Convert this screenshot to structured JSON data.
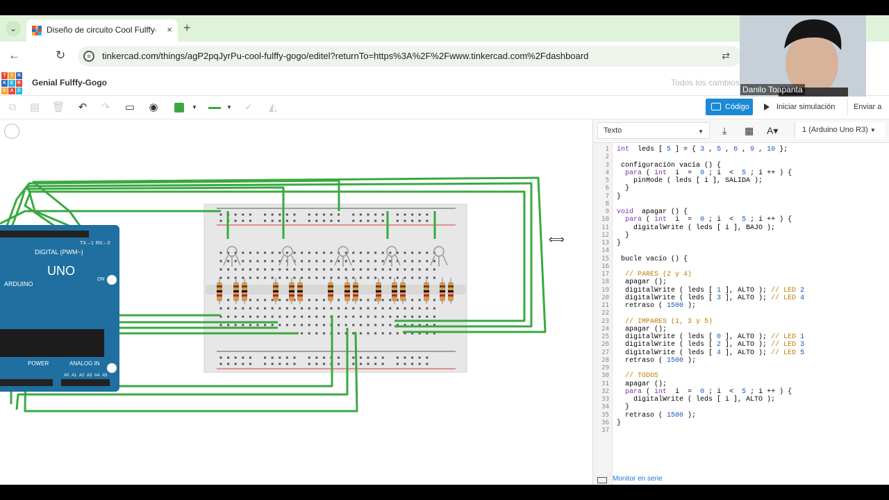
{
  "browser": {
    "tab_title": "Diseño de circuito Cool Fulffy-G",
    "close_glyph": "×",
    "new_tab_glyph": "+",
    "url": "tinkercad.com/things/agP2pqJyrPu-cool-fulffy-gogo/editel?returnTo=https%3A%2F%2Fwww.tinkercad.com%2Fdashboard"
  },
  "tinkercad": {
    "logo_letters": [
      "T",
      "I",
      "N",
      "K",
      "E",
      "R",
      "C",
      "A",
      "D"
    ],
    "project_name": "Genial Fulffy-Gogo",
    "save_status": "Todos los cambios",
    "code_button": "Código",
    "simulate_button": "Iniciar simulación",
    "send_button": "Enviar a"
  },
  "code_panel": {
    "mode": "Texto",
    "board": "1 (Arduino Uno R3)",
    "serial_monitor": "Monitor en serie",
    "lines": [
      "int  leds [ 5 ] = { 3 , 5 , 6 , 9 , 10 };",
      "",
      " configuración vacía () {",
      "  para ( int  i  =  0 ; i  <  5 ; i ++ ) {",
      "    pinMode ( leds [ i ], SALIDA );",
      "  }",
      "}",
      "",
      "void  apagar () {",
      "  para ( int  i  =  0 ; i  <  5 ; i ++ ) {",
      "    digitalWrite ( leds [ i ], BAJO );",
      "  }",
      "}",
      "",
      " bucle vacío () {",
      "",
      "  // PARES (2 y 4)",
      "  apagar ();",
      "  digitalWrite ( leds [ 1 ], ALTO ); // LED 2",
      "  digitalWrite ( leds [ 3 ], ALTO ); // LED 4",
      "  retraso ( 1500 );",
      "",
      "  // IMPARES (1, 3 y 5)",
      "  apagar ();",
      "  digitalWrite ( leds [ 0 ], ALTO ); // LED 1",
      "  digitalWrite ( leds [ 2 ], ALTO ); // LED 3",
      "  digitalWrite ( leds [ 4 ], ALTO ); // LED 5",
      "  retraso ( 1500 );",
      "",
      "  // TODOS",
      "  apagar ();",
      "  para ( int  i  =  0 ; i  <  5 ; i ++ ) {",
      "    digitalWrite ( leds [ i ], ALTO );",
      "  }",
      "  retraso ( 1500 );",
      "}",
      ""
    ]
  },
  "board_labels": {
    "digital": "DIGITAL (PWM~)",
    "uno": "UNO",
    "arduino": "ARDUINO",
    "on": "ON",
    "power": "POWER",
    "analog": "ANALOG IN",
    "tx": "TX→1",
    "rx": "RX←0",
    "analog_pins": [
      "A0",
      "A1",
      "A2",
      "A3",
      "A4",
      "A5"
    ]
  },
  "webcam": {
    "name": "Danilo Toapanta"
  },
  "colors": {
    "accent": "#1a8ad6",
    "wire": "#3aa841",
    "board": "#1f6fa0",
    "tab_bar": "#dff3d9"
  }
}
